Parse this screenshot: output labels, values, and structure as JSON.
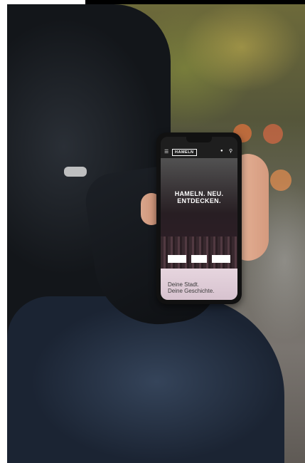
{
  "app": {
    "logo_text": "HAMELN",
    "hero_title_line1": "HAMELN. NEU.",
    "hero_title_line2": "ENTDECKEN.",
    "hero_text": "",
    "buttons": [
      "",
      "",
      ""
    ],
    "footer_line1": "Deine Stadt.",
    "footer_line2": "Deine Geschichte."
  },
  "icons": {
    "menu": "menu-icon",
    "user": "user-icon",
    "search": "search-icon"
  },
  "colors": {
    "footer_bg": "#e6d5de",
    "app_bar": "#1e1e1e",
    "phone_body": "#111111"
  }
}
